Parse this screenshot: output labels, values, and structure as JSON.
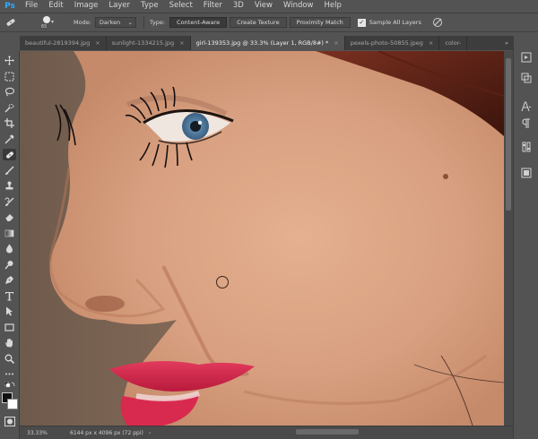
{
  "app": {
    "logo": "Ps"
  },
  "menu": [
    "File",
    "Edit",
    "Image",
    "Layer",
    "Type",
    "Select",
    "Filter",
    "3D",
    "View",
    "Window",
    "Help"
  ],
  "options": {
    "brush_size": "65",
    "mode_label": "Mode:",
    "mode_value": "Darken",
    "type_label": "Type:",
    "type_buttons": [
      "Content-Aware",
      "Create Texture",
      "Proximity Match"
    ],
    "sample_all_layers_label": "Sample All Layers",
    "sample_all_layers_checked": true
  },
  "tabs": [
    {
      "label": "beautiful-2819394.jpg",
      "active": false
    },
    {
      "label": "sunlight-1334215.jpg",
      "active": false
    },
    {
      "label": "girl-139353.jpg @ 33.3% (Layer 1, RGB/8#) *",
      "active": true
    },
    {
      "label": "pexels-photo-50855.jpeg",
      "active": false
    },
    {
      "label": "color-",
      "active": false
    }
  ],
  "tabs_overflow": "»",
  "tab_close": "×",
  "status": {
    "zoom": "33.33%",
    "doc_info": "6144 px x 4096 px (72 ppi)",
    "caret": "›"
  },
  "tools": [
    "move-tool",
    "marquee-tool",
    "lasso-tool",
    "quick-select-tool",
    "crop-tool",
    "eyedropper-tool",
    "spot-healing-tool",
    "brush-tool",
    "clone-stamp-tool",
    "history-brush-tool",
    "eraser-tool",
    "gradient-tool",
    "blur-tool",
    "dodge-tool",
    "pen-tool",
    "type-tool",
    "path-select-tool",
    "rectangle-tool",
    "hand-tool",
    "zoom-tool",
    "more-tools"
  ],
  "colors": {
    "ui_bg": "#535353",
    "ui_dark": "#3d3d3d",
    "ps_blue": "#31a8ff",
    "skin": "#d5a184",
    "lips": "#d4234a"
  }
}
